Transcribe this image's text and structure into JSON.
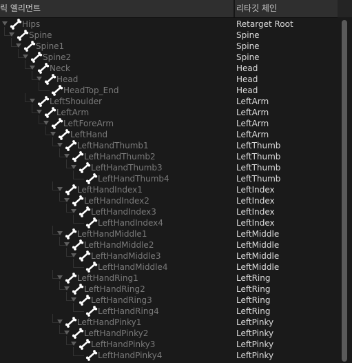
{
  "header": {
    "name_column": "릭 엘리먼트",
    "chain_column": "리타깃 체인"
  },
  "icons": {
    "expand": "triangle-down-icon",
    "bone": "bone-icon"
  },
  "colors": {
    "name_text": "#7a7a7a",
    "chain_text": "#dcdcdc",
    "bone_icon": "#ffffff",
    "header_bg": "#2f2f2f",
    "panel_bg": "#1a1a1a"
  },
  "bones": [
    {
      "name": "Hips",
      "chain": "Retarget Root",
      "depth": 0,
      "expanded": true
    },
    {
      "name": "Spine",
      "chain": "Spine",
      "depth": 1,
      "expanded": true
    },
    {
      "name": "Spine1",
      "chain": "Spine",
      "depth": 2,
      "expanded": true
    },
    {
      "name": "Spine2",
      "chain": "Spine",
      "depth": 3,
      "expanded": true
    },
    {
      "name": "Neck",
      "chain": "Head",
      "depth": 4,
      "expanded": true
    },
    {
      "name": "Head",
      "chain": "Head",
      "depth": 5,
      "expanded": true
    },
    {
      "name": "HeadTop_End",
      "chain": "Head",
      "depth": 6,
      "expanded": false
    },
    {
      "name": "LeftShoulder",
      "chain": "LeftArm",
      "depth": 4,
      "expanded": true
    },
    {
      "name": "LeftArm",
      "chain": "LeftArm",
      "depth": 5,
      "expanded": true
    },
    {
      "name": "LeftForeArm",
      "chain": "LeftArm",
      "depth": 6,
      "expanded": true
    },
    {
      "name": "LeftHand",
      "chain": "LeftArm",
      "depth": 7,
      "expanded": true
    },
    {
      "name": "LeftHandThumb1",
      "chain": "LeftThumb",
      "depth": 8,
      "expanded": true
    },
    {
      "name": "LeftHandThumb2",
      "chain": "LeftThumb",
      "depth": 9,
      "expanded": true
    },
    {
      "name": "LeftHandThumb3",
      "chain": "LeftThumb",
      "depth": 10,
      "expanded": true
    },
    {
      "name": "LeftHandThumb4",
      "chain": "LeftThumb",
      "depth": 11,
      "expanded": false
    },
    {
      "name": "LeftHandIndex1",
      "chain": "LeftIndex",
      "depth": 8,
      "expanded": true
    },
    {
      "name": "LeftHandIndex2",
      "chain": "LeftIndex",
      "depth": 9,
      "expanded": true
    },
    {
      "name": "LeftHandIndex3",
      "chain": "LeftIndex",
      "depth": 10,
      "expanded": true
    },
    {
      "name": "LeftHandIndex4",
      "chain": "LeftIndex",
      "depth": 11,
      "expanded": false
    },
    {
      "name": "LeftHandMiddle1",
      "chain": "LeftMiddle",
      "depth": 8,
      "expanded": true
    },
    {
      "name": "LeftHandMiddle2",
      "chain": "LeftMiddle",
      "depth": 9,
      "expanded": true
    },
    {
      "name": "LeftHandMiddle3",
      "chain": "LeftMiddle",
      "depth": 10,
      "expanded": true
    },
    {
      "name": "LeftHandMiddle4",
      "chain": "LeftMiddle",
      "depth": 11,
      "expanded": false
    },
    {
      "name": "LeftHandRing1",
      "chain": "LeftRing",
      "depth": 8,
      "expanded": true
    },
    {
      "name": "LeftHandRing2",
      "chain": "LeftRing",
      "depth": 9,
      "expanded": true
    },
    {
      "name": "LeftHandRing3",
      "chain": "LeftRing",
      "depth": 10,
      "expanded": true
    },
    {
      "name": "LeftHandRing4",
      "chain": "LeftRing",
      "depth": 11,
      "expanded": false
    },
    {
      "name": "LeftHandPinky1",
      "chain": "LeftPinky",
      "depth": 8,
      "expanded": true
    },
    {
      "name": "LeftHandPinky2",
      "chain": "LeftPinky",
      "depth": 9,
      "expanded": true
    },
    {
      "name": "LeftHandPinky3",
      "chain": "LeftPinky",
      "depth": 10,
      "expanded": true
    },
    {
      "name": "LeftHandPinky4",
      "chain": "LeftPinky",
      "depth": 11,
      "expanded": false
    }
  ]
}
